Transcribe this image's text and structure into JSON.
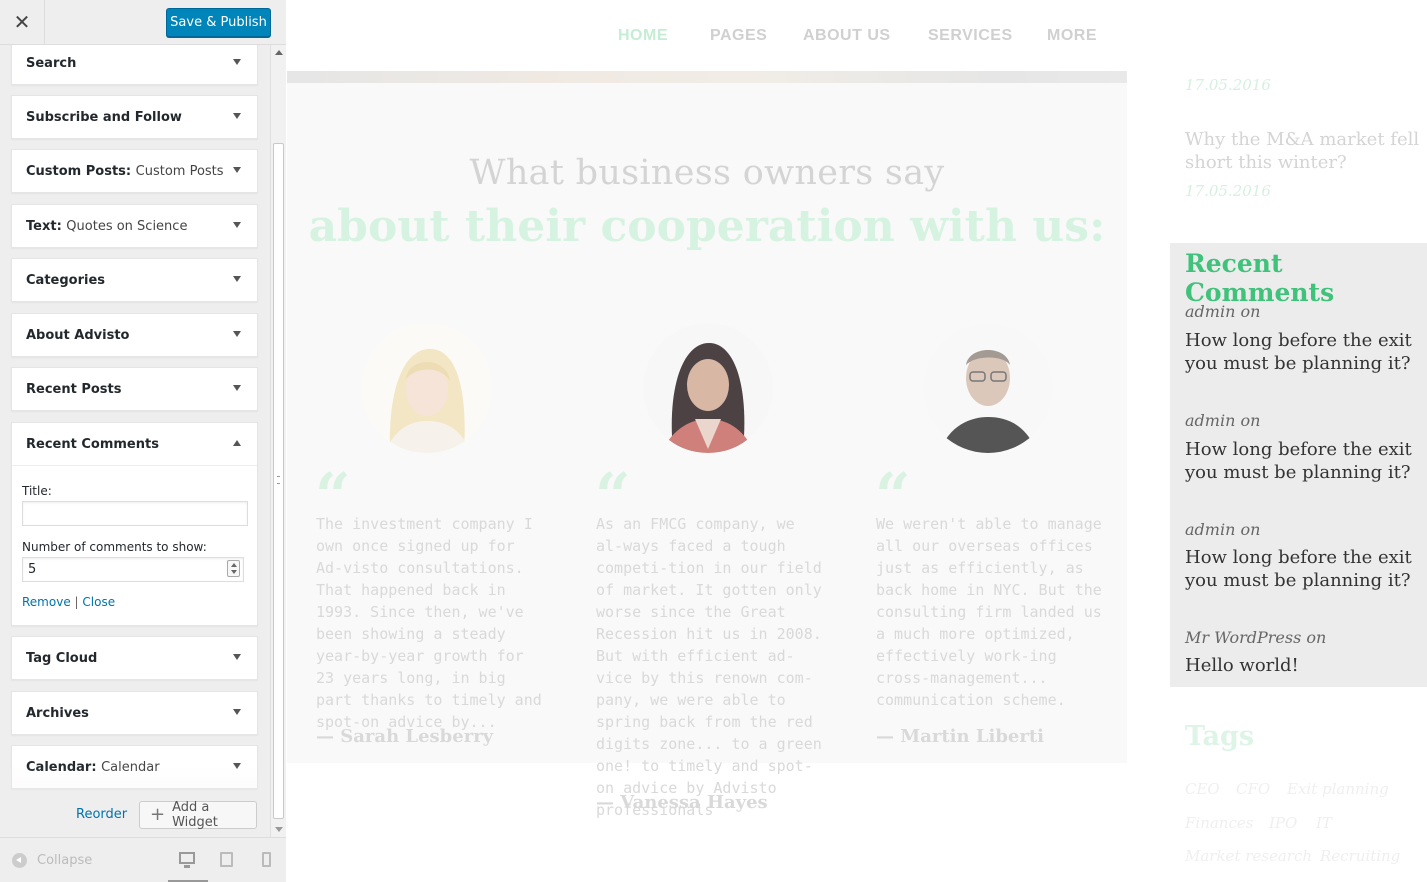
{
  "customizer": {
    "close_icon": "close-icon",
    "publish_label": "Save & Publish",
    "widgets": [
      {
        "title": "Search",
        "subtitle": ""
      },
      {
        "title": "Subscribe and Follow",
        "subtitle": ""
      },
      {
        "title": "Custom Posts",
        "subtitle": "Custom Posts"
      },
      {
        "title": "Text",
        "subtitle": "Quotes on Science"
      },
      {
        "title": "Categories",
        "subtitle": ""
      },
      {
        "title": "About Advisto",
        "subtitle": ""
      },
      {
        "title": "Recent Posts",
        "subtitle": ""
      },
      {
        "title": "Recent Comments",
        "subtitle": ""
      },
      {
        "title": "Tag Cloud",
        "subtitle": ""
      },
      {
        "title": "Archives",
        "subtitle": ""
      },
      {
        "title": "Calendar",
        "subtitle": "Calendar"
      }
    ],
    "recent_comments_form": {
      "title_label": "Title:",
      "title_value": "",
      "count_label": "Number of comments to show:",
      "count_value": "5",
      "remove_label": "Remove",
      "separator": "|",
      "close_label": "Close"
    },
    "reorder_label": "Reorder",
    "add_widget_label": "Add a Widget",
    "collapse_label": "Collapse",
    "devices": [
      "desktop",
      "tablet",
      "mobile"
    ],
    "active_device": "desktop",
    "accent_color": "#0085ba"
  },
  "preview": {
    "nav": [
      "HOME",
      "PAGES",
      "ABOUT US",
      "SERVICES",
      "MORE"
    ],
    "active_nav": "HOME",
    "heading_line1": "What business owners say",
    "heading_line2": "about their cooperation with us:",
    "testimonials": [
      {
        "text": "The investment company I own once signed up for Ad-visto consultations. That happened back in 1993. Since then, we've been showing a steady year-by-year growth for 23 years long, in big part thanks to timely and spot-on advice by...",
        "author": "— Sarah Lesberry"
      },
      {
        "text": "As an FMCG company, we al-ways faced a tough competi-tion in our field of market. It gotten only worse since the Great Recession hit us in 2008. But with efficient ad-vice by this renown com-pany, we were able to spring back from the red digits zone... to a green one! to timely and spot-on advice by Advisto professionals",
        "author": "— Vanessa Hayes"
      },
      {
        "text": "We weren't able to manage all our overseas offices just as efficiently, as back home in NYC. But the consulting firm landed us a much more optimized, effectively work-ing cross-management... communication scheme.",
        "author": "— Martin Liberti"
      }
    ],
    "sidebar": {
      "date_top": "17.05.2016",
      "post_title": "Why the M&A market fell short this winter?",
      "post_date": "17.05.2016",
      "recent_comments_title": "Recent Comments",
      "comments": [
        {
          "author": "admin on",
          "text": "How long before the exit you must be planning it?"
        },
        {
          "author": "admin on",
          "text": "How long before the exit you must be planning it?"
        },
        {
          "author": "admin on",
          "text": "How long before the exit you must be planning it?"
        },
        {
          "author": "Mr WordPress on",
          "text": "Hello world!"
        }
      ],
      "tags_title": "Tags",
      "tags": [
        "CEO",
        "CFO",
        "Exit planning",
        "Finances",
        "IPO",
        "IT",
        "Market research",
        "Recruiting"
      ]
    },
    "accent_color": "#3fc27a"
  }
}
